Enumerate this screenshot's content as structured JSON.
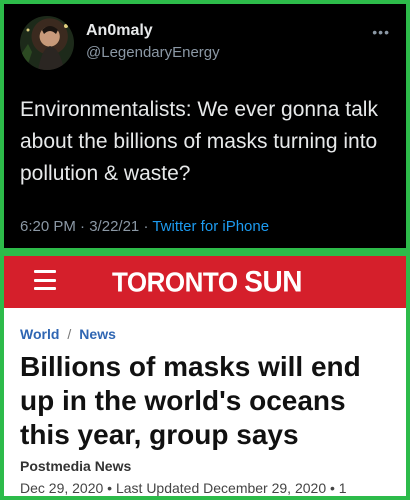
{
  "tweet": {
    "author_name": "An0maly",
    "author_handle": "@LegendaryEnergy",
    "more_icon": "more-horizontal-icon",
    "text": "Environmentalists: We ever gonna talk about the billions of masks turning into pollution & waste?",
    "time": "6:20 PM",
    "date": "3/22/21",
    "source": "Twitter for iPhone",
    "meta_sep": "·"
  },
  "news_site": {
    "menu_icon": "hamburger-menu-icon",
    "logo_part1": "TORONTO",
    "logo_part2": "SUN",
    "brand_color": "#d51f2b"
  },
  "article": {
    "breadcrumb": [
      "World",
      "News"
    ],
    "breadcrumb_sep": "/",
    "headline": "Billions of masks will end up in the world's oceans this year, group says",
    "byline": "Postmedia News",
    "dateline": "Dec 29, 2020  • Last Updated December 29, 2020  •  1"
  },
  "colors": {
    "border_green": "#2dbb4a",
    "link_blue": "#1d9bf0",
    "breadcrumb_blue": "#2f66b3"
  }
}
